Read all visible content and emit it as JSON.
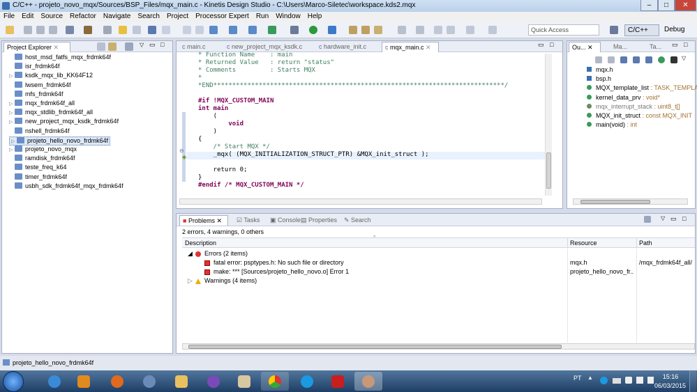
{
  "window": {
    "title": "C/C++ - projeto_novo_mqx/Sources/BSP_Files/mqx_main.c - Kinetis Design Studio - C:\\Users\\Marco-Siletec\\workspace.kds2.mqx",
    "minimize": "–",
    "maximize": "□",
    "close": "✕"
  },
  "menu": [
    "File",
    "Edit",
    "Source",
    "Refactor",
    "Navigate",
    "Search",
    "Project",
    "Processor Expert",
    "Run",
    "Window",
    "Help"
  ],
  "toolbar": {
    "quick_access_placeholder": "Quick Access",
    "perspective_cpp": "C/C++",
    "perspective_debug": "Debug"
  },
  "project_explorer": {
    "title": "Project Explorer",
    "items": [
      {
        "label": "host_msd_fatfs_mqx_frdmk64f",
        "twisty": ""
      },
      {
        "label": "isr_frdmk64f",
        "twisty": ""
      },
      {
        "label": "ksdk_mqx_lib_KK64F12",
        "twisty": "▷"
      },
      {
        "label": "lwsem_frdmk64f",
        "twisty": ""
      },
      {
        "label": "mfs_frdmk64f",
        "twisty": ""
      },
      {
        "label": "mqx_frdmk64f_all",
        "twisty": "▷"
      },
      {
        "label": "mqx_stdlib_frdmk64f_all",
        "twisty": "▷"
      },
      {
        "label": "new_project_mqx_ksdk_frdmk64f",
        "twisty": "▷"
      },
      {
        "label": "nshell_frdmk64f",
        "twisty": ""
      },
      {
        "label": "projeto_hello_novo_frdmk64f",
        "twisty": "▷"
      },
      {
        "label": "projeto_novo_mqx",
        "twisty": "▷"
      },
      {
        "label": "ramdisk_frdmk64f",
        "twisty": ""
      },
      {
        "label": "teste_freq_k64",
        "twisty": ""
      },
      {
        "label": "timer_frdmk64f",
        "twisty": ""
      },
      {
        "label": "usbh_sdk_frdmk64f_mqx_frdmk64f",
        "twisty": ""
      }
    ]
  },
  "editor": {
    "tabs": [
      "main.c",
      "new_project_mqx_ksdk.c",
      "hardware_init.c",
      "mqx_main.c"
    ],
    "lines": [
      "* Function Name    : main",
      "* Returned Value   : return \"status\"",
      "* Comments         : Starts MQX",
      "*",
      "*END*****************************************************************************/",
      "",
      "#if !MQX_CUSTOM_MAIN",
      "int main",
      "    (",
      "        void",
      "    )",
      "{",
      "    /* Start MQX */",
      "    _mqx( (MQX_INITIALIZATION_STRUCT_PTR) &MQX_init_struct );",
      "",
      "    return 0;",
      "}",
      "#endif /* MQX_CUSTOM_MAIN */"
    ]
  },
  "outline": {
    "tabs": [
      "Ou...",
      "Ma...",
      "Ta..."
    ],
    "items": [
      {
        "name": "mqx.h",
        "type": ""
      },
      {
        "name": "bsp.h",
        "type": ""
      },
      {
        "name": "MQX_template_list",
        "type": " : TASK_TEMPLA"
      },
      {
        "name": "kernel_data_prv",
        "type": " : void*"
      },
      {
        "name": "mqx_interrupt_stack",
        "type": " : uint8_t[]"
      },
      {
        "name": "MQX_init_struct",
        "type": " : const MQX_INIT"
      },
      {
        "name": "main(void)",
        "type": " : int"
      }
    ]
  },
  "problems": {
    "tabs": [
      "Problems",
      "Tasks",
      "Console",
      "Properties",
      "Search"
    ],
    "summary": "2 errors, 4 warnings, 0 others",
    "columns": [
      "Description",
      "Resource",
      "Path"
    ],
    "rows": [
      {
        "desc": "Errors (2 items)",
        "resource": "",
        "path": ""
      },
      {
        "desc": "fatal error: psptypes.h: No such file or directory",
        "resource": "mqx.h",
        "path": "/mqx_frdmk64f_all/"
      },
      {
        "desc": "make: *** [Sources/projeto_hello_novo.o] Error 1",
        "resource": "projeto_hello_novo_fr...",
        "path": ""
      },
      {
        "desc": "Warnings (4 items)",
        "resource": "",
        "path": ""
      }
    ]
  },
  "status": {
    "selected": "projeto_hello_novo_frdmk64f"
  },
  "taskbar": {
    "lang": "PT",
    "time": "15:16",
    "date": "06/03/2015"
  },
  "colors": {
    "accent": "#3a6fb0",
    "error": "#dd3333",
    "warning": "#e8b100"
  }
}
